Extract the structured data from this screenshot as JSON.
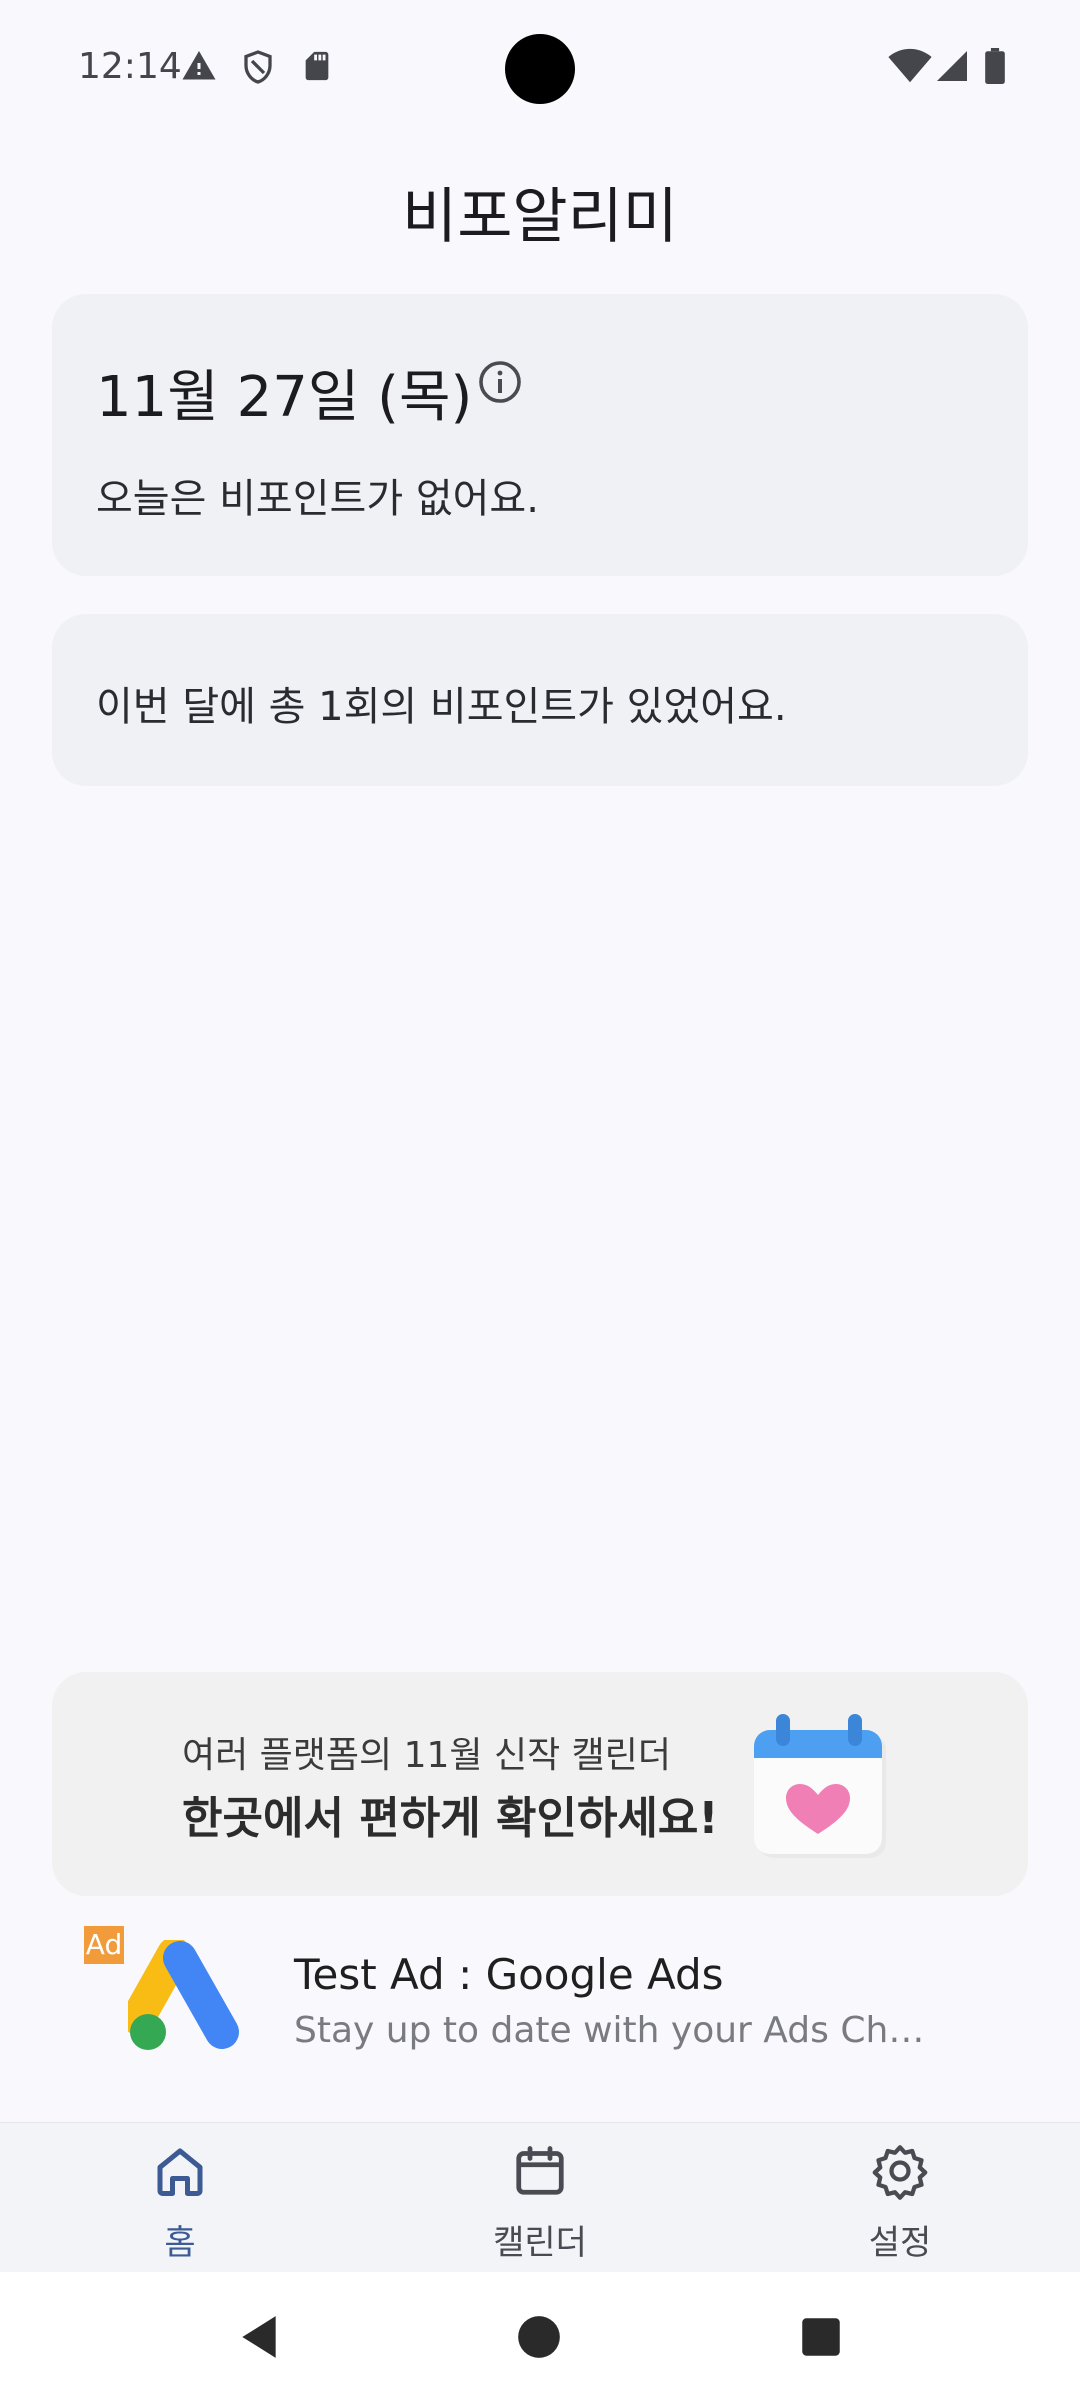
{
  "status_bar": {
    "time": "12:14",
    "icons": [
      "warning-icon",
      "shield-icon",
      "sd-card-icon",
      "wifi-icon",
      "signal-icon",
      "battery-icon"
    ]
  },
  "app": {
    "title": "비포알리미"
  },
  "today_card": {
    "date": "11월 27일 (목)",
    "message": "오늘은 비포인트가 없어요."
  },
  "month_card": {
    "message": "이번 달에 총 1회의 비포인트가 있었어요."
  },
  "promo": {
    "subtitle": "여러 플랫폼의 11월 신작 캘린더",
    "title": "한곳에서 편하게 확인하세요!"
  },
  "ad": {
    "badge": "Ad",
    "title": "Test Ad : Google Ads",
    "description": "Stay up to date with your Ads Check how your ads are performing"
  },
  "bottom_nav": {
    "items": [
      {
        "label": "홈",
        "icon": "home-icon",
        "active": true
      },
      {
        "label": "캘린더",
        "icon": "calendar-icon",
        "active": false
      },
      {
        "label": "설정",
        "icon": "gear-icon",
        "active": false
      }
    ]
  },
  "colors": {
    "background": "#f9f8fd",
    "card": "#f0f1f5",
    "accent": "#3c5a93",
    "ad_badge": "#f29b3b"
  }
}
